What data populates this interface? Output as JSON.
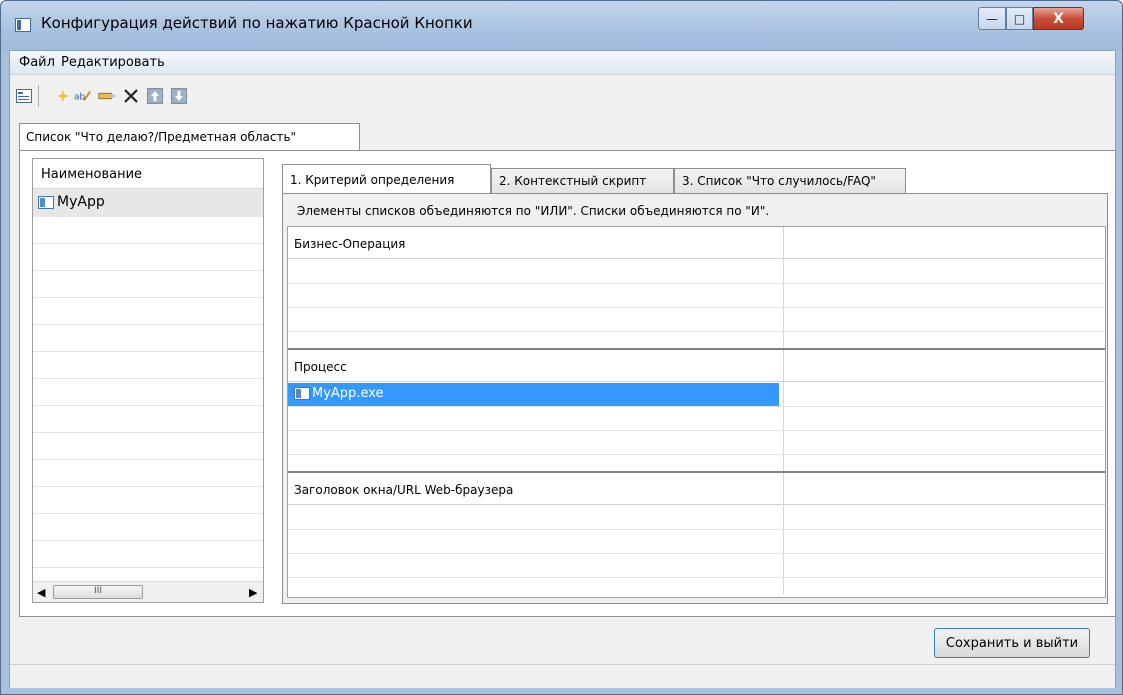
{
  "window": {
    "title": "Конфигурация действий по нажатию Красной Кнопки",
    "controls": {
      "minimize": "—",
      "maximize": "□",
      "close": "X"
    }
  },
  "menu": {
    "file": "Файл",
    "edit": "Редактировать"
  },
  "toolbar": {
    "icons": [
      "properties-icon",
      "new-icon",
      "rename-icon",
      "edit-icon",
      "delete-icon",
      "move-up-icon",
      "move-down-icon"
    ]
  },
  "outer_tab": {
    "label": "Список \"Что делаю?/Предметная область\""
  },
  "left_list": {
    "header": "Наименование",
    "items": [
      "MyApp"
    ],
    "scrollbar": {
      "thumb_grip": "III"
    }
  },
  "right_tabs": [
    {
      "label": "1. Критерий определения",
      "active": true
    },
    {
      "label": "2. Контекстный скрипт",
      "active": false
    },
    {
      "label": "3. Список \"Что случилось/FAQ\"",
      "active": false
    }
  ],
  "hint": "Элементы списков объединяются по \"ИЛИ\".  Списки объединяются по \"И\".",
  "groups": [
    {
      "header": "Бизнес-Операция",
      "rows": []
    },
    {
      "header": "Процесс",
      "rows": [
        "MyApp.exe"
      ]
    },
    {
      "header": "Заголовок окна/URL Web-браузера",
      "rows": []
    }
  ],
  "buttons": {
    "save_exit": "Сохранить и выйти"
  },
  "colors": {
    "selection": "#3399ff",
    "window_frame": "#a7c0dc",
    "close_button": "#c9503b"
  }
}
